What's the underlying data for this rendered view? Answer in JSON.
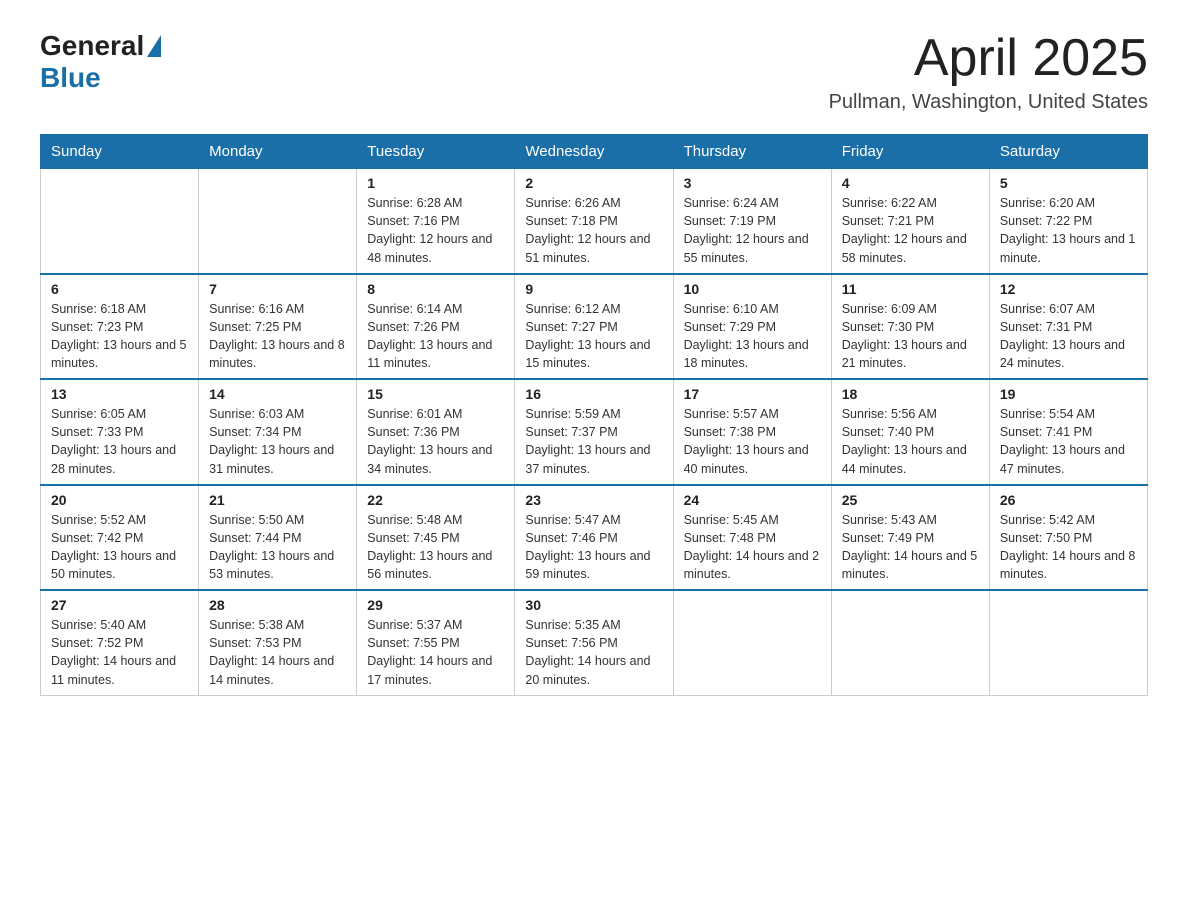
{
  "header": {
    "logo_text_general": "General",
    "logo_text_blue": "Blue",
    "month_year": "April 2025",
    "location": "Pullman, Washington, United States"
  },
  "days_of_week": [
    "Sunday",
    "Monday",
    "Tuesday",
    "Wednesday",
    "Thursday",
    "Friday",
    "Saturday"
  ],
  "weeks": [
    [
      {
        "day": "",
        "sunrise": "",
        "sunset": "",
        "daylight": ""
      },
      {
        "day": "",
        "sunrise": "",
        "sunset": "",
        "daylight": ""
      },
      {
        "day": "1",
        "sunrise": "Sunrise: 6:28 AM",
        "sunset": "Sunset: 7:16 PM",
        "daylight": "Daylight: 12 hours and 48 minutes."
      },
      {
        "day": "2",
        "sunrise": "Sunrise: 6:26 AM",
        "sunset": "Sunset: 7:18 PM",
        "daylight": "Daylight: 12 hours and 51 minutes."
      },
      {
        "day": "3",
        "sunrise": "Sunrise: 6:24 AM",
        "sunset": "Sunset: 7:19 PM",
        "daylight": "Daylight: 12 hours and 55 minutes."
      },
      {
        "day": "4",
        "sunrise": "Sunrise: 6:22 AM",
        "sunset": "Sunset: 7:21 PM",
        "daylight": "Daylight: 12 hours and 58 minutes."
      },
      {
        "day": "5",
        "sunrise": "Sunrise: 6:20 AM",
        "sunset": "Sunset: 7:22 PM",
        "daylight": "Daylight: 13 hours and 1 minute."
      }
    ],
    [
      {
        "day": "6",
        "sunrise": "Sunrise: 6:18 AM",
        "sunset": "Sunset: 7:23 PM",
        "daylight": "Daylight: 13 hours and 5 minutes."
      },
      {
        "day": "7",
        "sunrise": "Sunrise: 6:16 AM",
        "sunset": "Sunset: 7:25 PM",
        "daylight": "Daylight: 13 hours and 8 minutes."
      },
      {
        "day": "8",
        "sunrise": "Sunrise: 6:14 AM",
        "sunset": "Sunset: 7:26 PM",
        "daylight": "Daylight: 13 hours and 11 minutes."
      },
      {
        "day": "9",
        "sunrise": "Sunrise: 6:12 AM",
        "sunset": "Sunset: 7:27 PM",
        "daylight": "Daylight: 13 hours and 15 minutes."
      },
      {
        "day": "10",
        "sunrise": "Sunrise: 6:10 AM",
        "sunset": "Sunset: 7:29 PM",
        "daylight": "Daylight: 13 hours and 18 minutes."
      },
      {
        "day": "11",
        "sunrise": "Sunrise: 6:09 AM",
        "sunset": "Sunset: 7:30 PM",
        "daylight": "Daylight: 13 hours and 21 minutes."
      },
      {
        "day": "12",
        "sunrise": "Sunrise: 6:07 AM",
        "sunset": "Sunset: 7:31 PM",
        "daylight": "Daylight: 13 hours and 24 minutes."
      }
    ],
    [
      {
        "day": "13",
        "sunrise": "Sunrise: 6:05 AM",
        "sunset": "Sunset: 7:33 PM",
        "daylight": "Daylight: 13 hours and 28 minutes."
      },
      {
        "day": "14",
        "sunrise": "Sunrise: 6:03 AM",
        "sunset": "Sunset: 7:34 PM",
        "daylight": "Daylight: 13 hours and 31 minutes."
      },
      {
        "day": "15",
        "sunrise": "Sunrise: 6:01 AM",
        "sunset": "Sunset: 7:36 PM",
        "daylight": "Daylight: 13 hours and 34 minutes."
      },
      {
        "day": "16",
        "sunrise": "Sunrise: 5:59 AM",
        "sunset": "Sunset: 7:37 PM",
        "daylight": "Daylight: 13 hours and 37 minutes."
      },
      {
        "day": "17",
        "sunrise": "Sunrise: 5:57 AM",
        "sunset": "Sunset: 7:38 PM",
        "daylight": "Daylight: 13 hours and 40 minutes."
      },
      {
        "day": "18",
        "sunrise": "Sunrise: 5:56 AM",
        "sunset": "Sunset: 7:40 PM",
        "daylight": "Daylight: 13 hours and 44 minutes."
      },
      {
        "day": "19",
        "sunrise": "Sunrise: 5:54 AM",
        "sunset": "Sunset: 7:41 PM",
        "daylight": "Daylight: 13 hours and 47 minutes."
      }
    ],
    [
      {
        "day": "20",
        "sunrise": "Sunrise: 5:52 AM",
        "sunset": "Sunset: 7:42 PM",
        "daylight": "Daylight: 13 hours and 50 minutes."
      },
      {
        "day": "21",
        "sunrise": "Sunrise: 5:50 AM",
        "sunset": "Sunset: 7:44 PM",
        "daylight": "Daylight: 13 hours and 53 minutes."
      },
      {
        "day": "22",
        "sunrise": "Sunrise: 5:48 AM",
        "sunset": "Sunset: 7:45 PM",
        "daylight": "Daylight: 13 hours and 56 minutes."
      },
      {
        "day": "23",
        "sunrise": "Sunrise: 5:47 AM",
        "sunset": "Sunset: 7:46 PM",
        "daylight": "Daylight: 13 hours and 59 minutes."
      },
      {
        "day": "24",
        "sunrise": "Sunrise: 5:45 AM",
        "sunset": "Sunset: 7:48 PM",
        "daylight": "Daylight: 14 hours and 2 minutes."
      },
      {
        "day": "25",
        "sunrise": "Sunrise: 5:43 AM",
        "sunset": "Sunset: 7:49 PM",
        "daylight": "Daylight: 14 hours and 5 minutes."
      },
      {
        "day": "26",
        "sunrise": "Sunrise: 5:42 AM",
        "sunset": "Sunset: 7:50 PM",
        "daylight": "Daylight: 14 hours and 8 minutes."
      }
    ],
    [
      {
        "day": "27",
        "sunrise": "Sunrise: 5:40 AM",
        "sunset": "Sunset: 7:52 PM",
        "daylight": "Daylight: 14 hours and 11 minutes."
      },
      {
        "day": "28",
        "sunrise": "Sunrise: 5:38 AM",
        "sunset": "Sunset: 7:53 PM",
        "daylight": "Daylight: 14 hours and 14 minutes."
      },
      {
        "day": "29",
        "sunrise": "Sunrise: 5:37 AM",
        "sunset": "Sunset: 7:55 PM",
        "daylight": "Daylight: 14 hours and 17 minutes."
      },
      {
        "day": "30",
        "sunrise": "Sunrise: 5:35 AM",
        "sunset": "Sunset: 7:56 PM",
        "daylight": "Daylight: 14 hours and 20 minutes."
      },
      {
        "day": "",
        "sunrise": "",
        "sunset": "",
        "daylight": ""
      },
      {
        "day": "",
        "sunrise": "",
        "sunset": "",
        "daylight": ""
      },
      {
        "day": "",
        "sunrise": "",
        "sunset": "",
        "daylight": ""
      }
    ]
  ]
}
